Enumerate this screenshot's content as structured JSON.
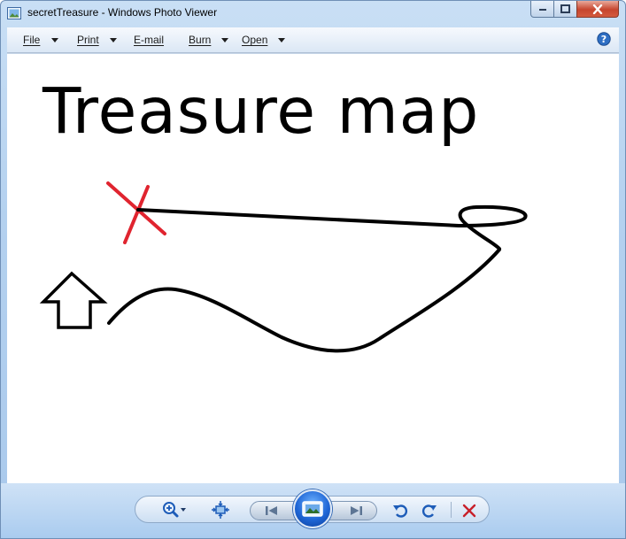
{
  "window": {
    "title": "secretTreasure - Windows Photo Viewer"
  },
  "menu": {
    "items": [
      {
        "label": "File",
        "has_dropdown": true
      },
      {
        "label": "Print",
        "has_dropdown": true
      },
      {
        "label": "E-mail",
        "has_dropdown": false
      },
      {
        "label": "Burn",
        "has_dropdown": true
      },
      {
        "label": "Open",
        "has_dropdown": true
      }
    ],
    "help_icon": "help-icon"
  },
  "image": {
    "heading": "Treasure map",
    "x_mark_color": "#e0242f",
    "path_color": "#000000"
  },
  "toolbar": {
    "buttons": [
      {
        "name": "zoom",
        "icon": "magnifier-plus-icon"
      },
      {
        "name": "actual-size",
        "icon": "fit-window-icon"
      },
      {
        "name": "previous",
        "icon": "skip-previous-icon"
      },
      {
        "name": "slideshow",
        "icon": "slideshow-icon"
      },
      {
        "name": "next",
        "icon": "skip-next-icon"
      },
      {
        "name": "rotate-counterclockwise",
        "icon": "rotate-left-icon"
      },
      {
        "name": "rotate-clockwise",
        "icon": "rotate-right-icon"
      },
      {
        "name": "delete",
        "icon": "delete-x-icon"
      }
    ],
    "delete_color": "#c8202a",
    "accent_blue": "#1f66d6"
  }
}
